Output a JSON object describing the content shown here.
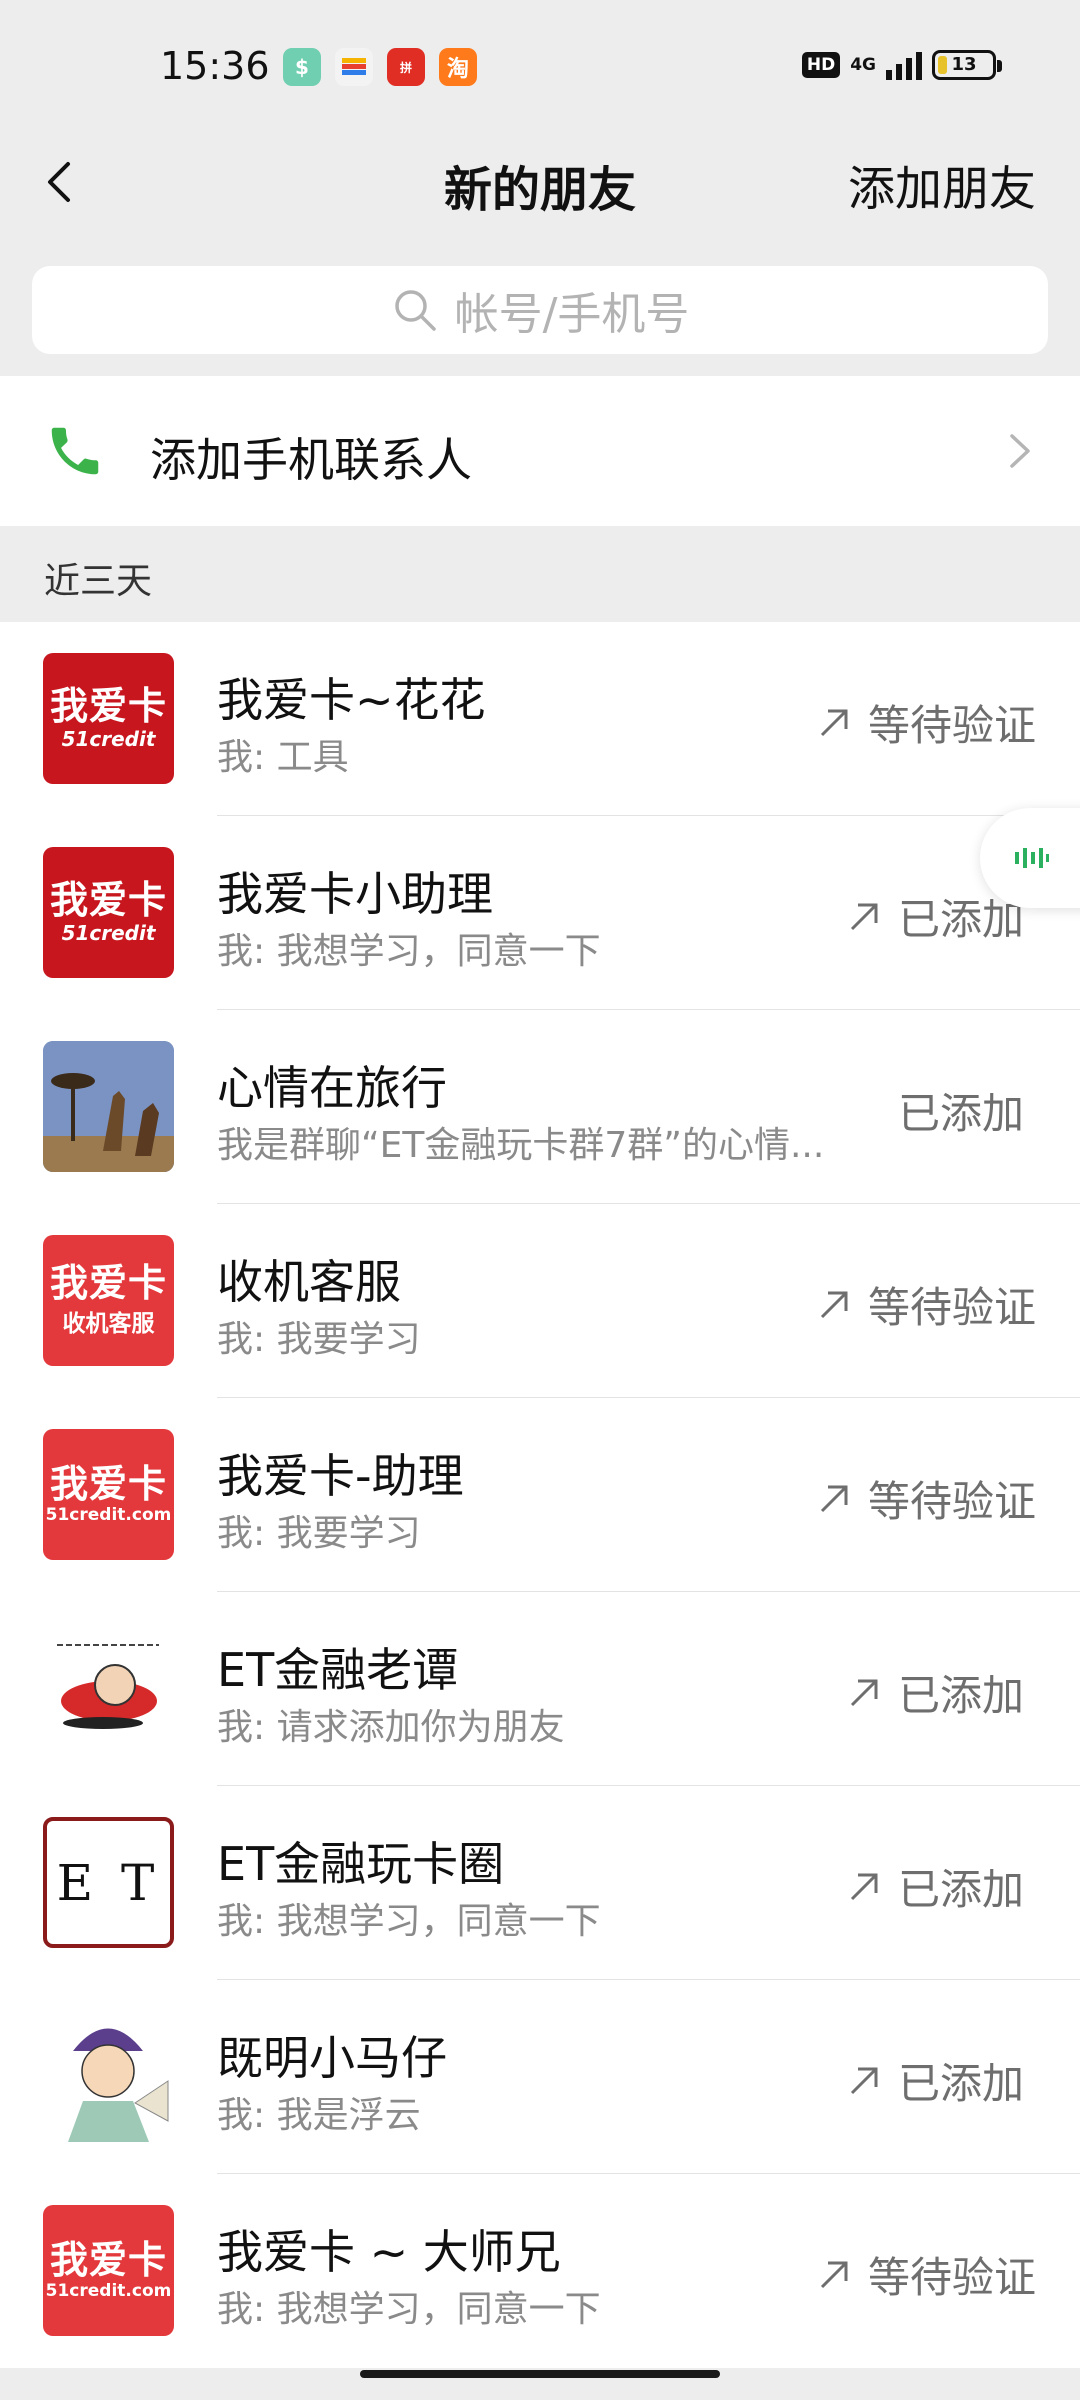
{
  "status_bar": {
    "time": "15:36",
    "network": "4G",
    "battery": "13",
    "hd": "HD",
    "app_icons": [
      "finance-app-icon",
      "wallet-app-icon",
      "pinduoduo-icon",
      "taobao-icon"
    ]
  },
  "nav": {
    "title": "新的朋友",
    "action": "添加朋友"
  },
  "search": {
    "placeholder": "帐号/手机号"
  },
  "add_contacts": {
    "label": "添加手机联系人"
  },
  "section": {
    "header": "近三天"
  },
  "friends": [
    {
      "name": "我爱卡~花花",
      "message": "我: 工具",
      "status": "等待验证",
      "avatar": {
        "style": "red",
        "line1": "我爱卡",
        "line2": "51credit"
      }
    },
    {
      "name": "我爱卡小助理",
      "message": "我: 我想学习，同意一下",
      "status": "已添加",
      "avatar": {
        "style": "red",
        "line1": "我爱卡",
        "line2": "51credit"
      }
    },
    {
      "name": "心情在旅行",
      "message": "我是群聊“ET金融玩卡群7群”的心情...",
      "status": "已添加",
      "avatar": {
        "style": "photo"
      }
    },
    {
      "name": "收机客服",
      "message": "我: 我要学习",
      "status": "等待验证",
      "avatar": {
        "style": "red2",
        "line1": "我爱卡",
        "line2": "收机客服"
      }
    },
    {
      "name": "我爱卡-助理",
      "message": "我: 我要学习",
      "status": "等待验证",
      "avatar": {
        "style": "red2",
        "line1": "我爱卡",
        "line2": "51credit.com"
      }
    },
    {
      "name": "ET金融老谭",
      "message": "我: 请求添加你为朋友",
      "status": "已添加",
      "avatar": {
        "style": "cartoon"
      }
    },
    {
      "name": "ET金融玩卡圈",
      "message": "我: 我想学习，同意一下",
      "status": "已添加",
      "avatar": {
        "style": "et",
        "line1": "E T"
      }
    },
    {
      "name": "既明小马仔",
      "message": "我: 我是浮云",
      "status": "已添加",
      "avatar": {
        "style": "character"
      }
    },
    {
      "name": "我爱卡 ~ 大师兄",
      "message": "我: 我想学习，同意一下",
      "status": "等待验证",
      "avatar": {
        "style": "red2",
        "line1": "我爱卡",
        "line2": "51credit.com"
      }
    }
  ],
  "colors": {
    "background": "#ededed",
    "phone_green": "#3cb34a",
    "avatar_red": "#c7161e",
    "avatar_red_light": "#e4393c"
  }
}
